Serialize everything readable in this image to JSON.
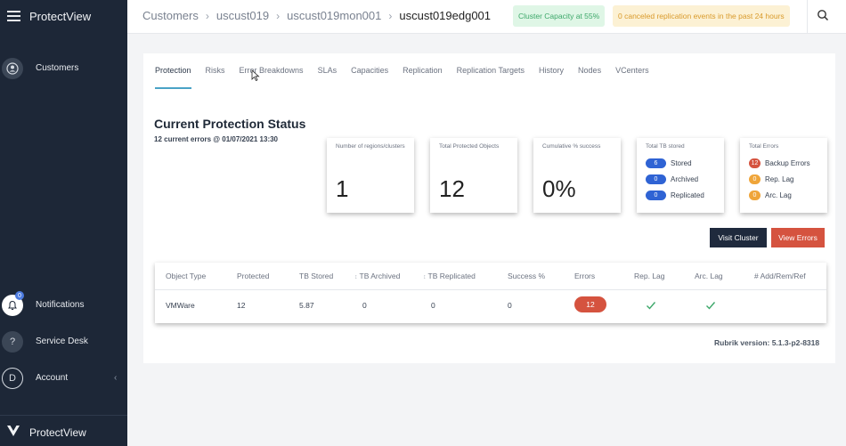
{
  "app": {
    "brand": "ProtectView"
  },
  "sidebar": {
    "customers": {
      "label": "Customers"
    },
    "notifications": {
      "label": "Notifications",
      "badge": "0"
    },
    "service_desk": {
      "label": "Service Desk",
      "glyph": "?"
    },
    "account": {
      "label": "Account",
      "initial": "D"
    }
  },
  "header": {
    "breadcrumbs": [
      "Customers",
      "uscust019",
      "uscust019mon001",
      "uscust019edg001"
    ],
    "capacity_alert": "Cluster Capacity at 55%",
    "replication_alert": "0 canceled replication events in the past 24 hours"
  },
  "tabs": [
    "Protection",
    "Risks",
    "Error Breakdowns",
    "SLAs",
    "Capacities",
    "Replication",
    "Replication Targets",
    "History",
    "Nodes",
    "VCenters"
  ],
  "section": {
    "title": "Current Protection Status",
    "subtitle": "12 current errors @ 01/07/2021 13:30"
  },
  "kpis": {
    "regions": {
      "label": "Number of regions/clusters",
      "value": "1"
    },
    "protected": {
      "label": "Total Protected Objects",
      "value": "12"
    },
    "success": {
      "label": "Cumulative % success",
      "value": "0%"
    },
    "tb": {
      "label": "Total TB stored",
      "rows": [
        {
          "count": "6",
          "label": "Stored"
        },
        {
          "count": "0",
          "label": "Archived"
        },
        {
          "count": "0",
          "label": "Replicated"
        }
      ]
    },
    "errors": {
      "label": "Total Errors",
      "rows": [
        {
          "count": "12",
          "label": "Backup Errors"
        },
        {
          "count": "0",
          "label": "Rep. Lag"
        },
        {
          "count": "0",
          "label": "Arc. Lag"
        }
      ]
    }
  },
  "actions": {
    "visit_cluster": "Visit Cluster",
    "view_errors": "View Errors"
  },
  "table": {
    "headers": [
      "Object Type",
      "Protected",
      "TB Stored",
      "TB Archived",
      "TB Replicated",
      "Success %",
      "Errors",
      "Rep. Lag",
      "Arc. Lag",
      "# Add/Rem/Ref"
    ],
    "row": {
      "object_type": "VMWare",
      "protected": "12",
      "tb_stored": "5.87",
      "tb_archived": "0",
      "tb_replicated": "0",
      "success": "0",
      "errors": "12"
    }
  },
  "footer": {
    "version": "Rubrik version: 5.1.3-p2-8318"
  },
  "colors": {
    "sidebar": "#1d2737",
    "accent": "#4aa3c6",
    "danger": "#d5533f",
    "primary_chip": "#2f63d4",
    "warning": "#efa53a"
  },
  "icons": [
    "menu-icon",
    "user-icon",
    "bell-icon",
    "question-icon",
    "chevron-left-icon",
    "logo-v-icon",
    "search-icon",
    "check-icon",
    "sort-icon",
    "cursor-icon"
  ]
}
